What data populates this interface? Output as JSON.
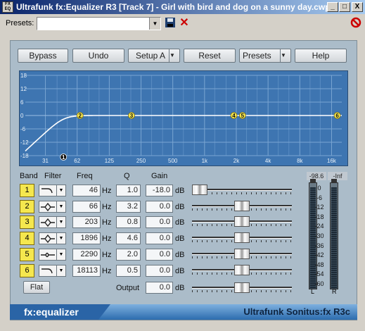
{
  "window": {
    "title": "Ultrafunk fx:Equalizer R3 [Track 7] - Girl with bird and dog on a sunny day.cwp",
    "app_icon_text": "FX EQ",
    "minimize": "_",
    "maximize": "□",
    "close": "X"
  },
  "presets_bar": {
    "label": "Presets:",
    "value": ""
  },
  "toolbar": {
    "bypass": "Bypass",
    "undo": "Undo",
    "setup": "Setup A",
    "reset": "Reset",
    "presets": "Presets",
    "help": "Help"
  },
  "graph": {
    "y_ticks": [
      "18",
      "12",
      "6",
      "0",
      "-6",
      "-12",
      "-18"
    ],
    "x_ticks": [
      "31",
      "62",
      "125",
      "250",
      "500",
      "1k",
      "2k",
      "4k",
      "8k",
      "16k"
    ],
    "bands": [
      {
        "label": "1",
        "freq": 46,
        "gain": -18.0
      },
      {
        "label": "2",
        "freq": 66,
        "gain": 0.0
      },
      {
        "label": "3",
        "freq": 203,
        "gain": 0.0
      },
      {
        "label": "4",
        "freq": 1896,
        "gain": 0.0
      },
      {
        "label": "5",
        "freq": 2290,
        "gain": 0.0
      },
      {
        "label": "6",
        "freq": 18113,
        "gain": 0.0
      }
    ]
  },
  "headers": {
    "band": "Band",
    "filter": "Filter",
    "freq": "Freq",
    "q": "Q",
    "gain": "Gain"
  },
  "bands": [
    {
      "label": "1",
      "filter": "high-pass-icon",
      "freq": "46",
      "hz": "Hz",
      "q": "1.0",
      "gain": "-18.0",
      "db": "dB",
      "level": 0.0
    },
    {
      "label": "2",
      "filter": "peak-icon",
      "freq": "66",
      "hz": "Hz",
      "q": "3.2",
      "gain": "0.0",
      "db": "dB",
      "level": 0.5
    },
    {
      "label": "3",
      "filter": "peak-icon",
      "freq": "203",
      "hz": "Hz",
      "q": "0.8",
      "gain": "0.0",
      "db": "dB",
      "level": 0.5
    },
    {
      "label": "4",
      "filter": "peak-icon",
      "freq": "1896",
      "hz": "Hz",
      "q": "4.6",
      "gain": "0.0",
      "db": "dB",
      "level": 0.5
    },
    {
      "label": "5",
      "filter": "notch-icon",
      "freq": "2290",
      "hz": "Hz",
      "q": "2.0",
      "gain": "0.0",
      "db": "dB",
      "level": 0.5
    },
    {
      "label": "6",
      "filter": "high-pass-icon",
      "freq": "18113",
      "hz": "Hz",
      "q": "0.5",
      "gain": "0.0",
      "db": "dB",
      "level": 0.5
    }
  ],
  "flat": "Flat",
  "output": {
    "label": "Output",
    "value": "0.0",
    "db": "dB",
    "level": 0.5
  },
  "meters": {
    "left_peak": "-98.6",
    "right_peak": "-Inf",
    "scale": [
      "0",
      "-6",
      "-12",
      "-18",
      "-24",
      "-30",
      "-36",
      "-42",
      "-48",
      "-54",
      "-60"
    ],
    "left_label": "L",
    "right_label": "R"
  },
  "footer": {
    "logo": "fx:equalizer",
    "product": "Ultrafunk Sonitus:fx R3c"
  },
  "colors": {
    "graph_bg": "#3e75b1",
    "band_button": "#f5e74e",
    "title_bar": "#0a246a",
    "footer": "#2c6cae"
  }
}
